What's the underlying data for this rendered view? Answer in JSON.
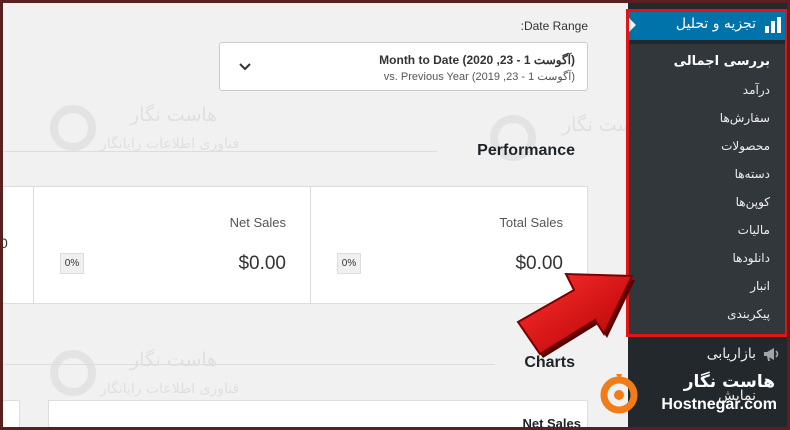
{
  "date_range": {
    "label": ":Date Range",
    "main": "Month to Date (آگوست 1 - 23, 2020)",
    "sub": "vs. Previous Year (آگوست 1 - 23, 2019)"
  },
  "performance": {
    "title": "Performance",
    "cells": [
      {
        "label": "Total Sales",
        "value": "$0.00",
        "badge": "0%"
      },
      {
        "label": "Net Sales",
        "value": "$0.00",
        "badge": "0%"
      }
    ],
    "stub_text": "0"
  },
  "charts": {
    "title": "Charts",
    "card_title": "Net Sales"
  },
  "sidebar": {
    "active_menu": "تجزیه و تحلیل",
    "submenu": [
      "بررسی اجمالی",
      "درآمد",
      "سفارش‌ها",
      "محصولات",
      "دسته‌ها",
      "کوپن‌ها",
      "مالیات",
      "دانلودها",
      "انبار",
      "پیکربندی"
    ],
    "menu_marketing": "بازاریابی",
    "menu_appearance": "نمایش"
  },
  "watermark": {
    "line1": "هاست نگار",
    "line2": "فناوری اطلاعات رایانگار"
  },
  "brand": {
    "name_fa": "هاست نگار",
    "name_en": "Hostnegar.com"
  },
  "colors": {
    "sidebar_bg": "#23282d",
    "submenu_bg": "#32373c",
    "active_blue": "#0073aa",
    "highlight_red": "#e01515",
    "brand_orange": "#f07d1a"
  }
}
